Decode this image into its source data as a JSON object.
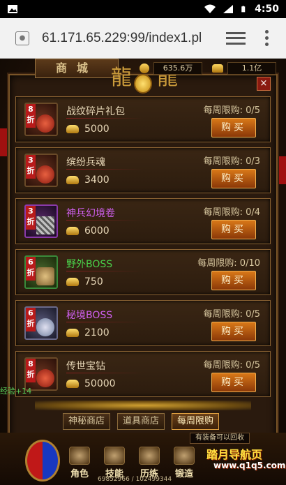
{
  "status_bar": {
    "time": "4:50"
  },
  "browser": {
    "url": "61.171.65.229:99/index1.pl"
  },
  "shop": {
    "title": "商城",
    "gold_amount": "635.6万",
    "ingot_amount": "1.1亿",
    "close_label": "×"
  },
  "items": [
    {
      "name": "战纹碎片礼包",
      "discount": "8折",
      "price": "5000",
      "limit": "每周限购: 0/5",
      "buy_label": "购买",
      "quality": "red",
      "name_color": "default"
    },
    {
      "name": "缤纷兵魂",
      "discount": "3折",
      "price": "3400",
      "limit": "每周限购: 0/3",
      "buy_label": "购买",
      "quality": "red",
      "name_color": "default"
    },
    {
      "name": "神兵幻境卷",
      "discount": "3折",
      "price": "6000",
      "limit": "每周限购: 0/4",
      "buy_label": "购买",
      "quality": "purple",
      "name_color": "purple"
    },
    {
      "name": "野外BOSS",
      "discount": "6折",
      "price": "750",
      "limit": "每周限购: 0/10",
      "buy_label": "购买",
      "quality": "green",
      "name_color": "green"
    },
    {
      "name": "秘境BOSS",
      "discount": "6折",
      "price": "2100",
      "limit": "每周限购: 0/5",
      "buy_label": "购买",
      "quality": "blue",
      "name_color": "purple"
    },
    {
      "name": "传世宝钻",
      "discount": "8折",
      "price": "50000",
      "limit": "每周限购: 0/5",
      "buy_label": "购买",
      "quality": "red",
      "name_color": "default"
    }
  ],
  "shop_tabs": [
    {
      "label": "神秘商店",
      "active": false
    },
    {
      "label": "道具商店",
      "active": false
    },
    {
      "label": "每周限购",
      "active": true
    }
  ],
  "hud": {
    "exp_gain": "经验+14",
    "equip_tip": "有装备可以回收",
    "exp_progress": "69852966 / 102499344",
    "skills": [
      "角色",
      "技能",
      "历练",
      "锻造"
    ],
    "brand": "踏月导航页",
    "brand_url": "www.q1q5.com"
  }
}
